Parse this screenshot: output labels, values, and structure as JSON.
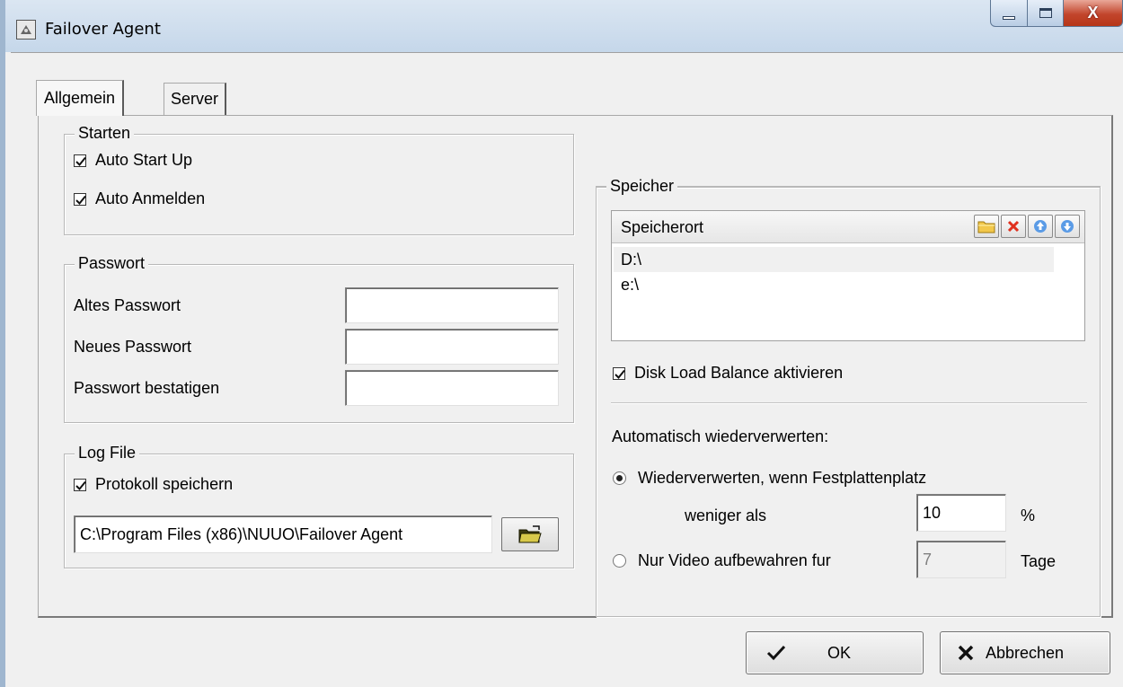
{
  "window": {
    "title": "Failover Agent",
    "close_glyph": "X"
  },
  "tabs": [
    {
      "label": "Allgemein",
      "active": true
    },
    {
      "label": "Server",
      "active": false
    }
  ],
  "starten": {
    "legend": "Starten",
    "auto_start_up": {
      "label": "Auto Start Up",
      "checked": true
    },
    "auto_anmelden": {
      "label": "Auto Anmelden",
      "checked": true
    }
  },
  "passwort": {
    "legend": "Passwort",
    "altes": {
      "label": "Altes Passwort",
      "value": ""
    },
    "neues": {
      "label": "Neues Passwort",
      "value": ""
    },
    "bestatigen": {
      "label": "Passwort bestatigen",
      "value": ""
    }
  },
  "logfile": {
    "legend": "Log File",
    "protokoll": {
      "label": "Protokoll speichern",
      "checked": true
    },
    "path": "C:\\Program Files (x86)\\NUUO\\Failover Agent"
  },
  "speicher": {
    "legend": "Speicher",
    "column_header": "Speicherort",
    "locations": [
      "D:\\",
      "e:\\"
    ],
    "selected_index": 0,
    "disk_load_balance": {
      "label": "Disk Load Balance aktivieren",
      "checked": true
    },
    "recycle_heading": "Automatisch wiederverwerten:",
    "option_disk": {
      "label": "Wiederverwerten, wenn Festplattenplatz",
      "selected": true,
      "sub_label": "weniger als",
      "value": "10",
      "unit": "%"
    },
    "option_days": {
      "label": "Nur Video aufbewahren fur",
      "selected": false,
      "value": "7",
      "unit": "Tage"
    }
  },
  "buttons": {
    "ok": "OK",
    "cancel": "Abbrechen"
  },
  "colors": {
    "window_bg": "#f0f0f0",
    "title_bar": "#c5d7ea",
    "close_red": "#c2452c"
  }
}
